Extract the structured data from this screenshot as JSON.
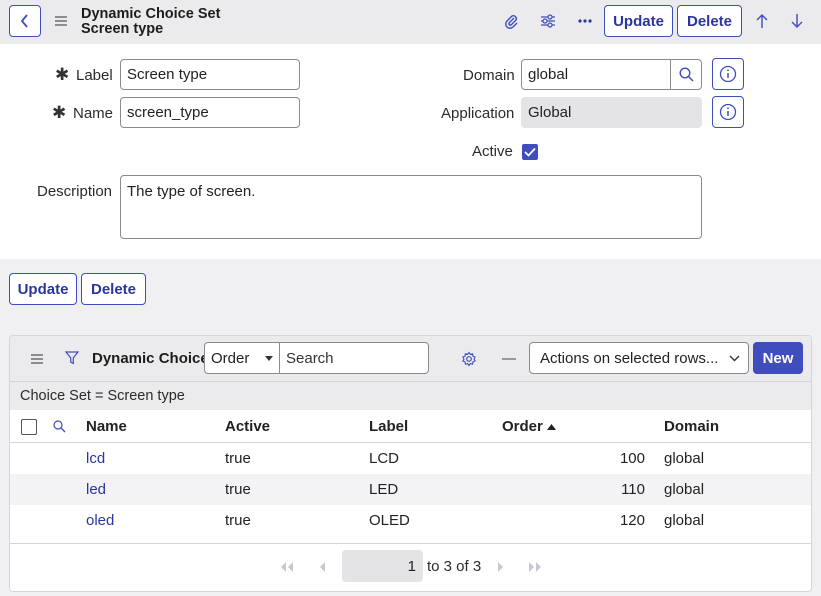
{
  "header": {
    "title_line1": "Dynamic Choice Set",
    "title_line2": "Screen type",
    "update_label": "Update",
    "delete_label": "Delete"
  },
  "form": {
    "label_label": "Label",
    "label_value": "Screen type",
    "name_label": "Name",
    "name_value": "screen_type",
    "domain_label": "Domain",
    "domain_value": "global",
    "application_label": "Application",
    "application_value": "Global",
    "active_label": "Active",
    "active_checked": true,
    "description_label": "Description",
    "description_value": "The type of screen."
  },
  "actions": {
    "update_label": "Update",
    "delete_label": "Delete"
  },
  "related_list": {
    "title": "Dynamic Choices",
    "search_field": "Order",
    "search_placeholder": "Search",
    "actions_select": "Actions on selected rows...",
    "new_label": "New",
    "filter_text": "Choice Set = Screen type",
    "columns": [
      "Name",
      "Active",
      "Label",
      "Order",
      "Domain"
    ],
    "sort_column": "Order",
    "rows": [
      {
        "name": "lcd",
        "active": "true",
        "label": "LCD",
        "order": "100",
        "domain": "global"
      },
      {
        "name": "led",
        "active": "true",
        "label": "LED",
        "order": "110",
        "domain": "global"
      },
      {
        "name": "oled",
        "active": "true",
        "label": "OLED",
        "order": "120",
        "domain": "global"
      }
    ],
    "pager": {
      "current": "1",
      "range_text": "to 3 of 3"
    }
  },
  "colors": {
    "accent": "#3f4dbd",
    "link": "#2a35a0",
    "header_bg": "#ebebed"
  }
}
